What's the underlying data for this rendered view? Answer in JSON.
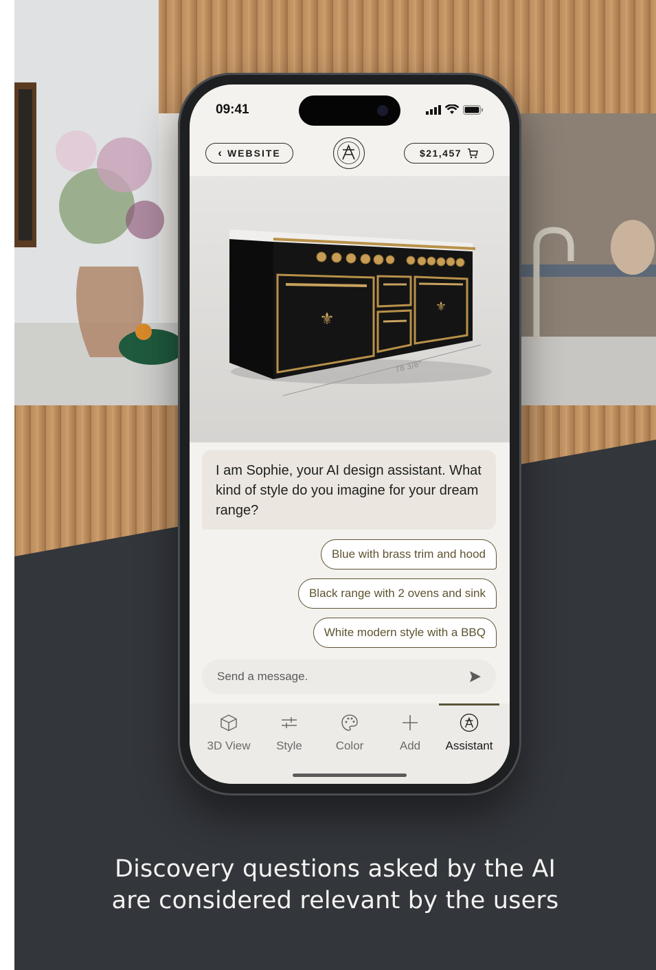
{
  "status_bar": {
    "time": "09:41"
  },
  "header": {
    "back_label": "WEBSITE",
    "cart_total": "$21,457"
  },
  "product": {
    "dimension_label": "78 3/8\""
  },
  "chat": {
    "assistant_message": "I am Sophie, your AI design assistant. What kind of style do you imagine for your dream range?",
    "suggestions": [
      "Blue with brass trim and hood",
      "Black range with 2 ovens and sink",
      "White modern style with a BBQ"
    ],
    "composer_placeholder": "Send a message."
  },
  "tabbar": {
    "active": "Assistant",
    "tabs": [
      {
        "label": "3D View",
        "icon": "cube-icon"
      },
      {
        "label": "Style",
        "icon": "sliders-icon"
      },
      {
        "label": "Color",
        "icon": "palette-icon"
      },
      {
        "label": "Add",
        "icon": "plus-icon"
      },
      {
        "label": "Assistant",
        "icon": "brand-logo-icon"
      }
    ]
  },
  "caption": {
    "line1": "Discovery questions asked by the AI",
    "line2": "are considered relevant by the users"
  },
  "colors": {
    "accent_brass": "#b8914a",
    "range_black": "#141414",
    "suggestion_border": "#5a5030",
    "background_dark": "#33363b"
  }
}
